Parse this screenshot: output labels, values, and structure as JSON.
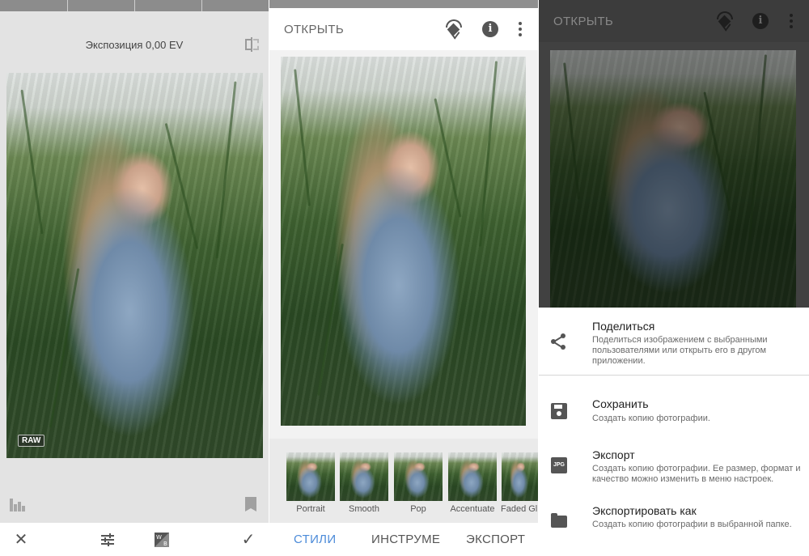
{
  "editor": {
    "exposure_label": "Экспозиция 0,00 EV",
    "raw_badge": "RAW"
  },
  "main": {
    "open_label": "ОТКРЫТЬ",
    "styles": [
      {
        "label": "Portrait"
      },
      {
        "label": "Smooth"
      },
      {
        "label": "Pop"
      },
      {
        "label": "Accentuate"
      },
      {
        "label": "Faded Gl"
      }
    ],
    "tabs": [
      {
        "label": "СТИЛИ"
      },
      {
        "label": "ИНСТРУМЕ"
      },
      {
        "label": "ЭКСПОРТ"
      }
    ]
  },
  "export_sheet": {
    "open_label": "ОТКРЫТЬ",
    "items": [
      {
        "title": "Поделиться",
        "desc": "Поделиться изображением с выбранными пользователями или открыть его в другом приложении.",
        "icon": "share-icon"
      },
      {
        "title": "Сохранить",
        "desc": "Создать копию фотографии.",
        "icon": "save-icon"
      },
      {
        "title": "Экспорт",
        "desc": "Создать копию фотографии. Ее размер, формат и качество можно изменить в меню настроек.",
        "icon": "jpg-icon"
      },
      {
        "title": "Экспортировать как",
        "desc": "Создать копию фотографии в выбранной папке.",
        "icon": "folder-icon"
      }
    ]
  },
  "colors": {
    "accent": "#4c8bd9",
    "sheet_bg": "#ffffff",
    "editor_bg": "#e3e3e3"
  }
}
